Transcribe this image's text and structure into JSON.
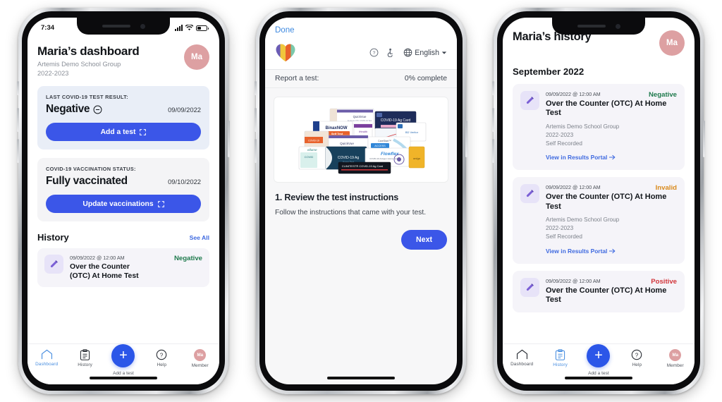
{
  "phone1": {
    "statusbar": {
      "time": "7:34",
      "signal_icon": "cellular-bars-icon",
      "wifi_icon": "wifi-icon",
      "battery_icon": "battery-icon"
    },
    "header": {
      "title": "Maria’s dashboard",
      "subtitle": "Artemis Demo School Group\n2022-2023",
      "avatar_initials": "Ma",
      "avatar_color": "#dda0a2"
    },
    "test_card": {
      "label": "LAST COVID-19 TEST RESULT:",
      "value": "Negative",
      "value_icon": "minus-circle-icon",
      "date": "09/09/2022",
      "button_label": "Add a test",
      "button_icon": "expand-icon",
      "bg_color": "#e9eef7"
    },
    "vax_card": {
      "label": "COVID-19 VACCINATION STATUS:",
      "value": "Fully vaccinated",
      "date": "09/10/2022",
      "button_label": "Update vaccinations",
      "button_icon": "expand-icon",
      "bg_color": "#f4f4f6"
    },
    "history": {
      "title": "History",
      "see_all": "See All",
      "item": {
        "time": "09/09/2022 @ 12:00 AM",
        "name": "Over the Counter (OTC) At Home Test",
        "result": "Negative",
        "result_color": "#1f7a4d",
        "icon": "test-tube-icon"
      }
    },
    "tabs": [
      {
        "label": "Dashboard",
        "icon": "home-icon",
        "active": true
      },
      {
        "label": "History",
        "icon": "clipboard-icon",
        "active": false
      },
      {
        "label": "Add a test",
        "icon": "plus-icon",
        "active": false
      },
      {
        "label": "Help",
        "icon": "question-circle-icon",
        "active": false
      },
      {
        "label": "Member",
        "icon": "avatar-icon",
        "active": false,
        "initials": "Ma"
      }
    ]
  },
  "phone2": {
    "done_label": "Done",
    "logo_icon": "heart-logo-icon",
    "logo_colors": [
      "#6b5cb5",
      "#f0c63c",
      "#e8622c",
      "#7bc9ab"
    ],
    "tools": [
      {
        "icon": "question-circle-icon",
        "label": ""
      },
      {
        "icon": "accessibility-icon",
        "label": ""
      }
    ],
    "language": {
      "icon": "globe-icon",
      "label": "English",
      "chevron": "chevron-down-icon"
    },
    "progress": {
      "left": "Report a test:",
      "right": "0% complete",
      "percent": 0
    },
    "kit_image": {
      "icon": "covid-test-kits-collage",
      "alt": "Collage of COVID-19 at-home test kit boxes"
    },
    "step": {
      "heading": "1. Review the test instructions",
      "body": "Follow the instructions that came with your test.",
      "next_label": "Next"
    }
  },
  "phone3": {
    "header": {
      "title": "Maria’s history",
      "avatar_initials": "Ma",
      "avatar_color": "#dda0a2"
    },
    "month": "September 2022",
    "entries": [
      {
        "time": "09/09/2022 @ 12:00 AM",
        "name": "Over the Counter (OTC) At Home Test",
        "result": "Negative",
        "result_color": "#1f7a4d",
        "org": "Artemis Demo School Group\n2022-2023\nSelf Recorded",
        "link": "View in Results Portal",
        "link_icon": "arrow-right-icon",
        "icon": "test-tube-icon"
      },
      {
        "time": "09/09/2022 @ 12:00 AM",
        "name": "Over the Counter (OTC) At Home Test",
        "result": "Invalid",
        "result_color": "#d98a1c",
        "org": "Artemis Demo School Group\n2022-2023\nSelf Recorded",
        "link": "View in Results Portal",
        "link_icon": "arrow-right-icon",
        "icon": "test-tube-icon"
      },
      {
        "time": "09/09/2022 @ 12:00 AM",
        "name": "Over the Counter (OTC) At Home Test",
        "result": "Positive",
        "result_color": "#d2353a",
        "org": "",
        "link": "",
        "link_icon": "",
        "icon": "test-tube-icon"
      }
    ],
    "tabs": [
      {
        "label": "Dashboard",
        "icon": "home-icon",
        "active": false
      },
      {
        "label": "History",
        "icon": "clipboard-icon",
        "active": true
      },
      {
        "label": "Add a test",
        "icon": "plus-icon",
        "active": false
      },
      {
        "label": "Help",
        "icon": "question-circle-icon",
        "active": false
      },
      {
        "label": "Member",
        "icon": "avatar-icon",
        "active": false,
        "initials": "Ma"
      }
    ]
  },
  "theme": {
    "primary": "#3b56e8",
    "link": "#3f6ae0",
    "avatar": "#dda0a2"
  }
}
